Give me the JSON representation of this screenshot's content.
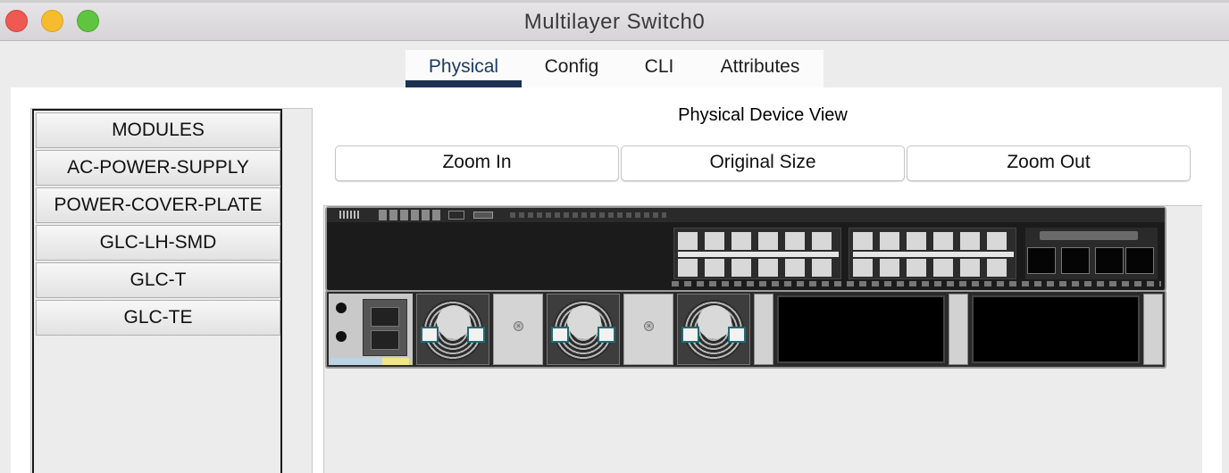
{
  "window": {
    "title": "Multilayer Switch0"
  },
  "tabs": [
    {
      "label": "Physical",
      "active": true
    },
    {
      "label": "Config",
      "active": false
    },
    {
      "label": "CLI",
      "active": false
    },
    {
      "label": "Attributes",
      "active": false
    }
  ],
  "modules": {
    "items": [
      "MODULES",
      "AC-POWER-SUPPLY",
      "POWER-COVER-PLATE",
      "GLC-LH-SMD",
      "GLC-T",
      "GLC-TE"
    ]
  },
  "device_view": {
    "title": "Physical Device View",
    "zoom_in_label": "Zoom In",
    "original_size_label": "Original Size",
    "zoom_out_label": "Zoom Out"
  },
  "colors": {
    "active_tab_underline": "#1c3152",
    "close": "#ee5a52",
    "minimize": "#f5bd2e",
    "zoom": "#5fc43f"
  }
}
